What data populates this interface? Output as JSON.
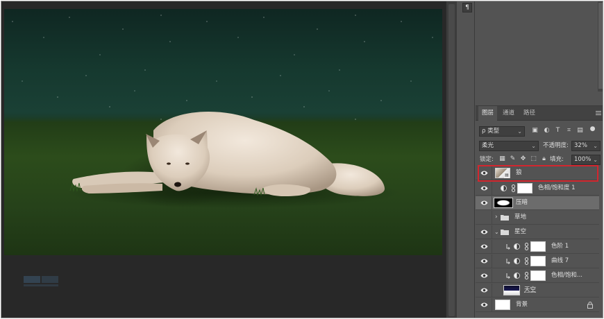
{
  "panel_strip": {
    "paragraph_glyph": "¶"
  },
  "layers_panel": {
    "tabs": [
      {
        "label": "图层",
        "active": true
      },
      {
        "label": "通道",
        "active": false
      },
      {
        "label": "路径",
        "active": false
      }
    ],
    "filter": {
      "label": "ρ 类型"
    },
    "blend_mode": "柔光",
    "opacity": {
      "label": "不透明度:",
      "value": "32%"
    },
    "lock": {
      "label": "锁定:"
    },
    "fill": {
      "label": "填充:",
      "value": "100%"
    },
    "layers": [
      {
        "name": "狼",
        "type": "image",
        "selected_outline": true
      },
      {
        "name": "色相/饱和度 1",
        "type": "adjustment"
      },
      {
        "name": "压暗",
        "type": "image",
        "highlighted": true
      },
      {
        "name": "草地",
        "type": "group",
        "expanded": false
      },
      {
        "name": "星空",
        "type": "group",
        "expanded": true
      },
      {
        "name": "色阶 1",
        "type": "adjustment",
        "clipped": true
      },
      {
        "name": "曲线 7",
        "type": "adjustment",
        "clipped": true
      },
      {
        "name": "色相/饱和...",
        "type": "adjustment",
        "clipped": true
      },
      {
        "name": "天空",
        "type": "image"
      },
      {
        "name": "背景",
        "type": "background",
        "locked": true
      }
    ]
  },
  "colors": {
    "panel_bg": "#535353",
    "workspace_bg": "#282828",
    "selection_outline": "#d3262e"
  }
}
